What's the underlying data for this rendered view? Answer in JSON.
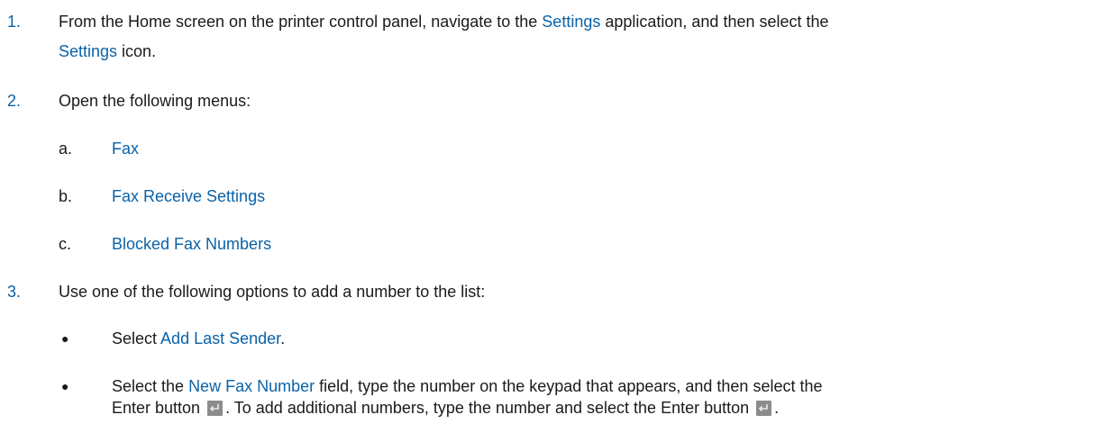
{
  "steps": [
    {
      "number": "1.",
      "line1_a": "From the Home screen on the printer control panel, navigate to the ",
      "line1_ui": "Settings",
      "line1_b": " application, and then select the",
      "line2_ui": "Settings",
      "line2_b": " icon."
    },
    {
      "number": "2.",
      "text": "Open the following menus:",
      "substeps": [
        {
          "letter": "a.",
          "label": "Fax"
        },
        {
          "letter": "b.",
          "label": "Fax Receive Settings"
        },
        {
          "letter": "c.",
          "label": "Blocked Fax Numbers"
        }
      ]
    },
    {
      "number": "3.",
      "text": "Use one of the following options to add a number to the list:",
      "bullets": [
        {
          "symbol": "●",
          "prefix": "Select ",
          "ui": "Add Last Sender",
          "suffix": "."
        },
        {
          "symbol": "●",
          "prefix": "Select the ",
          "ui": "New Fax Number",
          "mid": " field, type the number on the keypad that appears, and then select the",
          "line2_a": "Enter button",
          "line2_b": ". To add additional numbers, type the number and select the Enter button",
          "line2_c": "."
        }
      ]
    }
  ],
  "icons": {
    "enter": "enter-key-icon"
  }
}
